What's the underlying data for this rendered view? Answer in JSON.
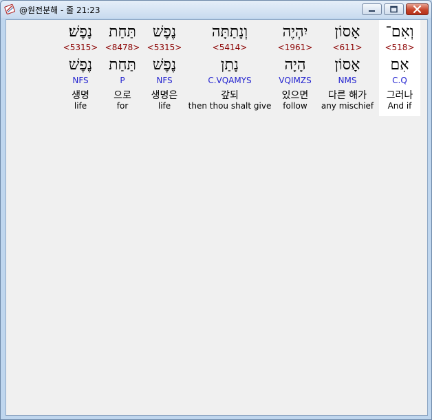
{
  "window": {
    "title": "@원전분해 - 줄 21:23",
    "controls": [
      "minimize",
      "maximize",
      "close"
    ],
    "close_color": "#c7452b"
  },
  "colors": {
    "strong_number": "#8b0000",
    "morphology": "#1f1fcf",
    "selected_word_background": "#ffffff"
  },
  "words": [
    {
      "hebrew": "וְאִם־",
      "strong": "<518>",
      "lemma": "אִם",
      "morph": "C.Q",
      "korean": "그러나",
      "english": "And if",
      "selected": true
    },
    {
      "hebrew": "אָסוֹן",
      "strong": "<611>",
      "lemma": "אָסוֹן",
      "morph": "NMS",
      "korean": "다른 해가",
      "english": "any mischief",
      "selected": false
    },
    {
      "hebrew": "יִהְיֶה",
      "strong": "<1961>",
      "lemma": "הָיָה",
      "morph": "VQIMZS",
      "korean": "있으면",
      "english": "follow",
      "selected": false
    },
    {
      "hebrew": "וְנָתַתָּה",
      "strong": "<5414>",
      "lemma": "נָתַן",
      "morph": "C.VQAMYS",
      "korean": "갚되",
      "english": "then thou shalt give",
      "selected": false
    },
    {
      "hebrew": "נֶפֶשׁ",
      "strong": "<5315>",
      "lemma": "נֶפֶשׁ",
      "morph": "NFS",
      "korean": "생명은",
      "english": "life",
      "selected": false
    },
    {
      "hebrew": "תַּחַת",
      "strong": "<8478>",
      "lemma": "תַּחַת",
      "morph": "P",
      "korean": "으로",
      "english": "for",
      "selected": false
    },
    {
      "hebrew": "נָפֶשׁ׃",
      "strong": "<5315>",
      "lemma": "נֶפֶשׁ",
      "morph": "NFS",
      "korean": "생명",
      "english": "life",
      "selected": false
    }
  ]
}
